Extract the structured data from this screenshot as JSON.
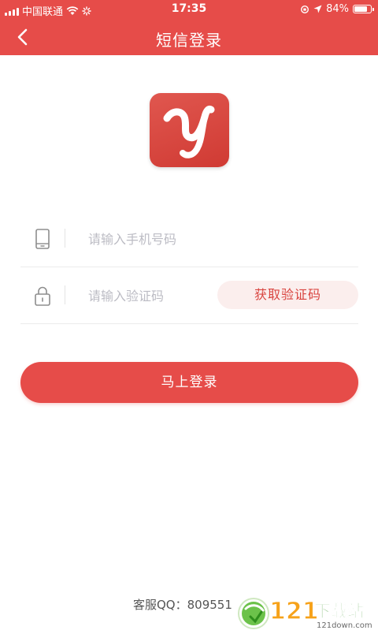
{
  "status_bar": {
    "carrier": "中国联通",
    "time": "17:35",
    "battery": "84%",
    "battery_level": 0.84
  },
  "nav": {
    "title": "短信登录"
  },
  "form": {
    "phone_placeholder": "请输入手机号码",
    "code_placeholder": "请输入验证码",
    "get_code_label": "获取验证码",
    "login_label": "马上登录"
  },
  "footer": {
    "service_text": "客服QQ：809551"
  },
  "watermark": {
    "number": "121",
    "brand": "下载站",
    "site": "121down.com"
  },
  "colors": {
    "primary": "#e64c49",
    "button_light": "#fbeeed",
    "placeholder": "#bcbcc4"
  },
  "icons": [
    "back-icon",
    "phone-icon",
    "lock-icon",
    "wifi-icon",
    "location-icon",
    "battery-icon"
  ]
}
